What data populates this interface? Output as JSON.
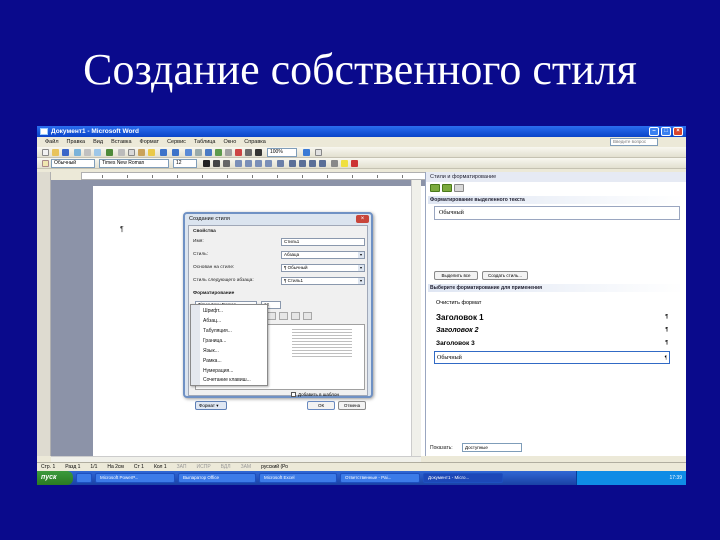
{
  "slide": {
    "title": "Создание собственного стиля"
  },
  "window": {
    "title": "Документ1 - Microsoft Word",
    "ask_placeholder": "Введите вопрос"
  },
  "menu": [
    "Файл",
    "Правка",
    "Вид",
    "Вставка",
    "Формат",
    "Сервис",
    "Таблица",
    "Окно",
    "Справка"
  ],
  "toolbar": {
    "style_combo": "Обычный",
    "font_combo": "Times New Roman",
    "size_combo": "12",
    "zoom_combo": "100%"
  },
  "document": {
    "para_mark": "¶"
  },
  "task_pane": {
    "title": "Стили и форматирование",
    "selected_text_header": "Форматирование выделенного текста",
    "current_style": "Обычный",
    "select_all_btn": "Выделить все",
    "new_style_btn": "Создать стиль...",
    "apply_header": "Выберите форматирование для применения",
    "clear_format": "Очистить формат",
    "styles": [
      "Заголовок 1",
      "Заголовок 2",
      "Заголовок 3",
      "Обычный"
    ],
    "show_label": "Показать:",
    "show_value": "Доступные"
  },
  "dialog": {
    "title": "Создание стиля",
    "section": "Свойства",
    "fields": [
      {
        "label": "Имя:",
        "value": "Стиль1"
      },
      {
        "label": "Стиль:",
        "value": "Абзаца"
      },
      {
        "label": "Основан на стиле:",
        "value": "¶ Обычный"
      },
      {
        "label": "Стиль следующего абзаца:",
        "value": "¶ Стиль1"
      }
    ],
    "format_section": "Форматирование",
    "font": "Times New Roman",
    "size": "12",
    "checkbox": "Добавить в шаблон",
    "format_button": "Формат ▾",
    "ok": "ОК",
    "cancel": "Отмена"
  },
  "context_menu": [
    "Шрифт...",
    "Абзац...",
    "Табуляция...",
    "Граница...",
    "Язык...",
    "Рамка...",
    "Нумерация...",
    "Сочетание клавиш..."
  ],
  "statusbar": [
    "Стр. 1",
    "Разд 1",
    "1/1",
    "На 2см",
    "Ст 1",
    "Кол 1",
    "ЗАП",
    "ИСПР",
    "ВДЛ",
    "ЗАМ",
    "русский (Ро"
  ],
  "taskbar": {
    "start": "пуск",
    "buttons": [
      "Microsoft PowerP...",
      "Выпаратор Office",
      "Microsoft Excel",
      "Ответственные - Pai...",
      "Документ1 - Micro..."
    ],
    "clock": "17:39"
  }
}
